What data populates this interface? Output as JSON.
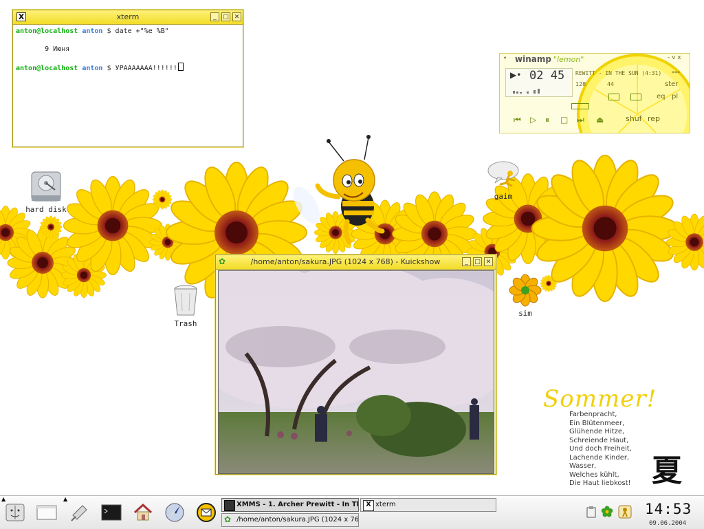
{
  "desktop": {
    "icons": {
      "hard_disk": "hard disk",
      "trash": "Trash",
      "gaim": "gaim",
      "sim": "sim"
    },
    "poem": {
      "title": "Sommer!",
      "lines": [
        "Farbenpracht,",
        "Ein Blütenmeer,",
        "Glühende Hitze,",
        "Schreiende Haut,",
        "Und doch Freiheit,",
        "Lachende Kinder,",
        "Wasser,",
        "Welches kühlt,",
        "Die Haut liebkost!"
      ],
      "kanji": "夏"
    }
  },
  "xterm": {
    "title": "xterm",
    "lines": [
      {
        "user": "anton@localhost",
        "dir": "anton",
        "prompt": "$",
        "cmd": "date +\"%e %B\""
      },
      {
        "output": " 9 Июня"
      },
      {
        "user": "anton@localhost",
        "dir": "anton",
        "prompt": "$",
        "cmd": "УРААААААА!!!!!!"
      }
    ]
  },
  "kuickshow": {
    "title": "/home/anton/sakura.JPG (1024 x 768) - Kuickshow"
  },
  "winamp": {
    "title": "winamp",
    "skin": "\"lemon\"",
    "win_controls": "- v x",
    "time": "02 45",
    "marquee": "REWITT - IN THE SUN (4:31)",
    "marquee_tail": "***",
    "bitrate": "128",
    "khz": "44",
    "ster": "ster",
    "eq": "eq",
    "pl": "pl",
    "shuf": "shuf",
    "rep": "rep"
  },
  "taskbar": {
    "tasks": [
      {
        "label": "XMMS - 1. Archer Prewitt - In Th"
      },
      {
        "label": "xterm"
      },
      {
        "label": "/home/anton/sakura.JPG (1024 x 76"
      }
    ],
    "clock": "14:53",
    "date": "09.06.2004"
  },
  "colors": {
    "accent": "#f2dc28",
    "petal": "#ffd800",
    "flower_center": "#9b1f1c"
  }
}
